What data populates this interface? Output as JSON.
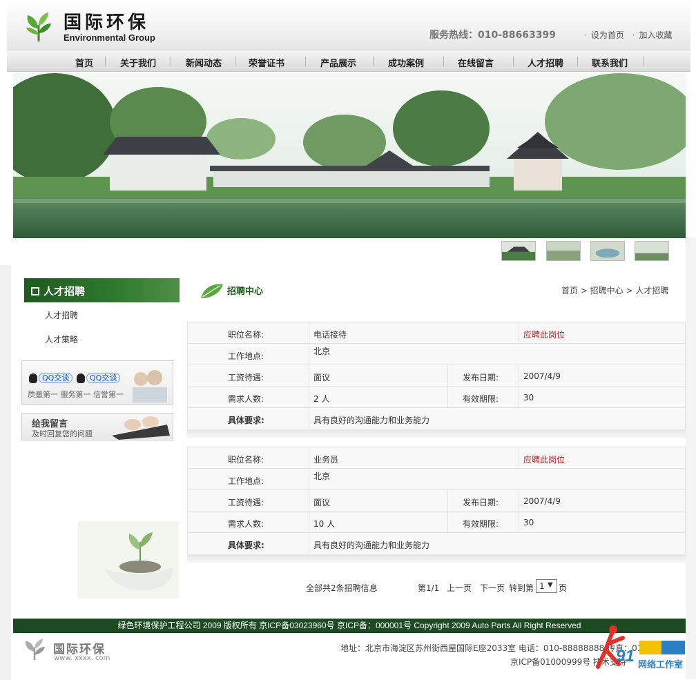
{
  "header": {
    "logo_cn": "国际环保",
    "logo_en": "Environmental Group",
    "hotline": "服务热线：010-88663399",
    "set_home": "设为首页",
    "add_fav": "加入收藏"
  },
  "nav": [
    "首页",
    "关于我们",
    "新闻动态",
    "荣誉证书",
    "产品展示",
    "成功案例",
    "在线留言",
    "人才招聘",
    "联系我们"
  ],
  "sidebar": {
    "title": "人才招聘",
    "links": [
      "人才招聘",
      "人才策略"
    ],
    "qq_label": "QQ交谈",
    "slogan": "质量第一  服务第一  信誉第一",
    "msg_title": "给我留言",
    "msg_sub": "及时回复您的问题"
  },
  "content": {
    "section_title": "招聘中心",
    "breadcrumb": "首页 > 招聘中心 > 人才招聘"
  },
  "labels": {
    "position": "职位名称:",
    "location": "工作地点:",
    "salary": "工资待遇:",
    "date": "发布日期:",
    "count": "需求人数:",
    "validity": "有效期限:",
    "requirement": "具体要求:",
    "apply": "应聘此岗位"
  },
  "jobs": [
    {
      "title": "电话接待",
      "location": "北京",
      "salary": "面议",
      "date": "2007/4/9",
      "count": "2 人",
      "validity": "30",
      "requirement": "具有良好的沟通能力和业务能力"
    },
    {
      "title": "业务员",
      "location": "北京",
      "salary": "面议",
      "date": "2007/4/9",
      "count": "10 人",
      "validity": "30",
      "requirement": "具有良好的沟通能力和业务能力"
    }
  ],
  "pager": {
    "total": "全部共2条招聘信息",
    "page": "第1/1",
    "prev": "上一页",
    "next": "下一页",
    "goto": "转到第",
    "selected": "1",
    "unit": "页"
  },
  "footer": {
    "copyright": "绿色环境保护工程公司 2009 版权所有 京ICP备03023960号 京ICP备：000001号 Copyright 2009 Auto Parts All Right Reserved",
    "logo_cn": "国际环保",
    "url": "www. xxxx. com",
    "address": "地址：北京市海淀区苏州街西屋国际E座2033室 电话：010-88888888  传真：010-8",
    "icp": "京ICP备01000999号 技术支持",
    "watermark": "网络工作室"
  },
  "colors": {
    "brand_green": "#1d4a23",
    "apply_red": "#b01e1e"
  }
}
